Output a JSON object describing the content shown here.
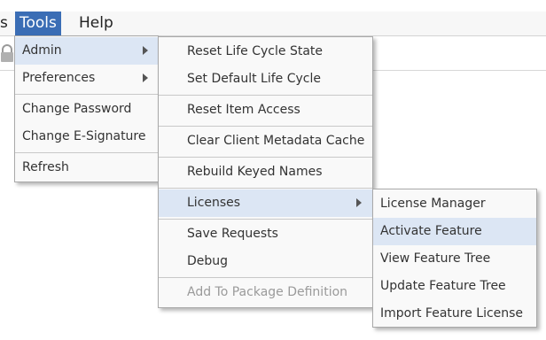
{
  "menubar": {
    "items": [
      {
        "label": "s"
      },
      {
        "label": "Tools"
      },
      {
        "label": "Help"
      }
    ]
  },
  "tools_menu": {
    "items": [
      {
        "label": "Admin"
      },
      {
        "label": "Preferences"
      },
      {
        "label": "Change Password"
      },
      {
        "label": "Change E-Signature"
      },
      {
        "label": "Refresh"
      }
    ]
  },
  "admin_menu": {
    "items": [
      {
        "label": "Reset Life Cycle State"
      },
      {
        "label": "Set Default Life Cycle"
      },
      {
        "label": "Reset Item Access"
      },
      {
        "label": "Clear Client Metadata Cache"
      },
      {
        "label": "Rebuild Keyed Names"
      },
      {
        "label": "Licenses"
      },
      {
        "label": "Save Requests"
      },
      {
        "label": "Debug"
      },
      {
        "label": "Add To Package Definition"
      }
    ]
  },
  "licenses_menu": {
    "items": [
      {
        "label": "License Manager"
      },
      {
        "label": "Activate Feature"
      },
      {
        "label": "View Feature Tree"
      },
      {
        "label": "Update Feature Tree"
      },
      {
        "label": "Import Feature License"
      }
    ]
  },
  "colors": {
    "menubar_active": "#3a6db5",
    "menu_highlight": "#dce6f4",
    "menu_background": "#f9f9f9",
    "disabled_text": "#9a9a9a"
  }
}
